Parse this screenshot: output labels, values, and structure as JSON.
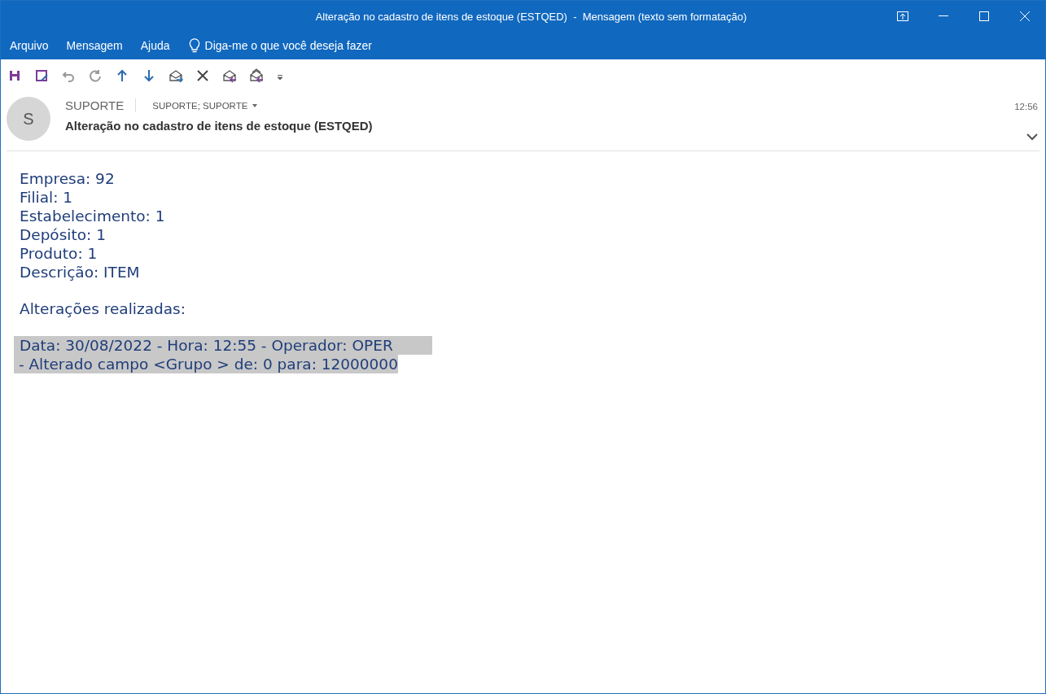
{
  "window": {
    "title": "Alteração no cadastro de itens de estoque (ESTQED)  -  Mensagem (texto sem formatação)"
  },
  "menu": [
    {
      "label": "Arquivo"
    },
    {
      "label": "Mensagem"
    },
    {
      "label": "Ajuda"
    }
  ],
  "tell_me": {
    "placeholder": "Diga-me o que você deseja fazer"
  },
  "header": {
    "avatar_initial": "S",
    "sender": "SUPORTE",
    "recipients": "SUPORTE; SUPORTE",
    "subject": "Alteração no cadastro de itens de estoque (ESTQED)",
    "time": "12:56"
  },
  "body": {
    "blocks": [
      [
        {
          "text": "Empresa: 92",
          "selected": false
        },
        {
          "text": "Filial: 1",
          "selected": false
        },
        {
          "text": "Estabelecimento: 1",
          "selected": false
        },
        {
          "text": "Depósito: 1",
          "selected": false
        },
        {
          "text": "Produto: 1",
          "selected": false
        },
        {
          "text": "Descrição: ITEM",
          "selected": false
        }
      ],
      [
        {
          "text": "Alterações realizadas:",
          "selected": false
        }
      ],
      [
        {
          "text": "Data: 30/08/2022 - Hora: 12:55 - Operador: OPER",
          "selected": true
        },
        {
          "text": " - Alterado campo <Grupo > de: 0 para: 12000000",
          "selected": true
        }
      ]
    ]
  }
}
